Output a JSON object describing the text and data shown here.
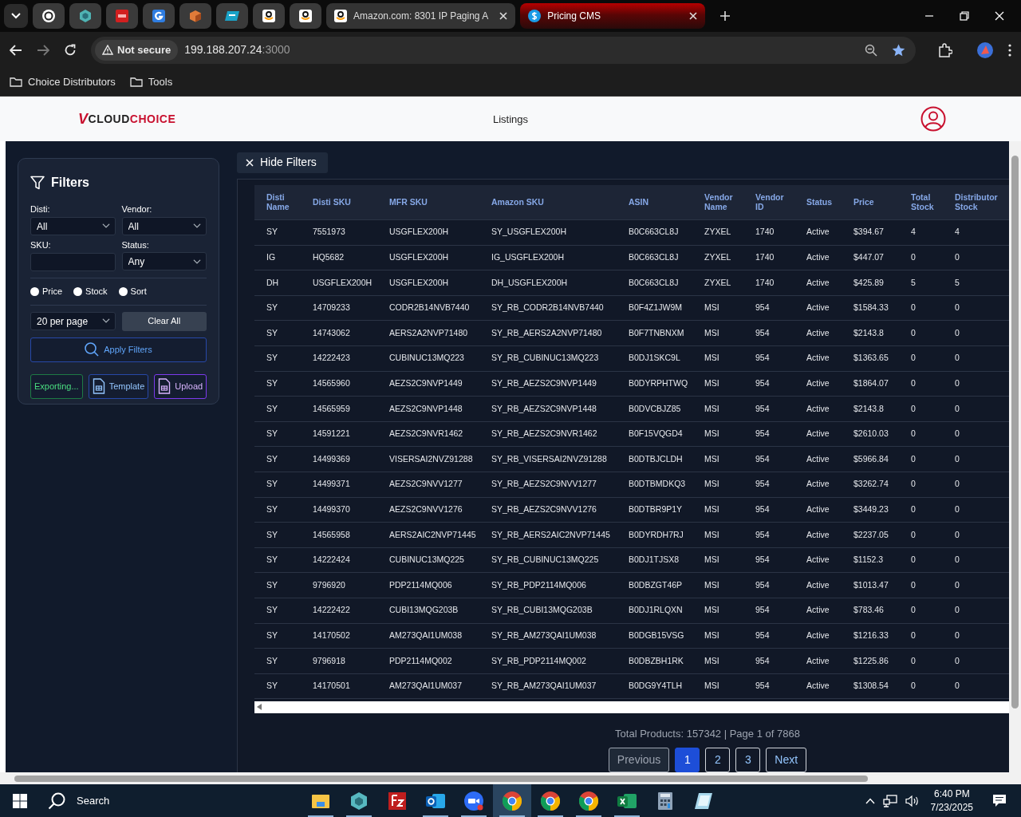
{
  "browser": {
    "tabs": [
      {
        "kind": "swirl",
        "selected": false
      },
      {
        "kind": "hexagon",
        "selected": false
      },
      {
        "kind": "tile",
        "selected": false
      },
      {
        "kind": "g-square",
        "selected": false
      },
      {
        "kind": "cube",
        "selected": false
      },
      {
        "kind": "badge",
        "selected": false
      },
      {
        "kind": "smile",
        "selected": false
      },
      {
        "kind": "smile",
        "selected": false
      },
      {
        "kind": "smile",
        "title": "Amazon.com: 8301 IP Paging A",
        "selected": false
      },
      {
        "kind": "dollar",
        "title": "Pricing CMS",
        "selected": true
      }
    ],
    "address": {
      "security": "Not secure",
      "host": "199.188.207.24",
      "port": ":3000"
    },
    "bookmarks": [
      "Choice Distributors",
      "Tools"
    ]
  },
  "app": {
    "logo": {
      "mark": "V",
      "word_1": "CLOUD",
      "word_2": "CHOICE"
    },
    "nav": "Listings"
  },
  "filters": {
    "title": "Filters",
    "fields": [
      {
        "label": "Disti:",
        "kind": "select",
        "value": "All"
      },
      {
        "label": "Vendor:",
        "kind": "select",
        "value": "All"
      },
      {
        "label": "SKU:",
        "kind": "text"
      },
      {
        "label": "Status:",
        "kind": "select",
        "value": "Any"
      }
    ],
    "radios": [
      {
        "label": "Price",
        "selected": false
      },
      {
        "label": "Stock",
        "selected": false
      },
      {
        "label": "Sort",
        "selected": false
      }
    ],
    "per_page": "20 per page",
    "clear": "Clear All",
    "apply": "Apply Filters",
    "actions": [
      {
        "label": "Exporting...",
        "kind": "export"
      },
      {
        "label": "Template",
        "kind": "template"
      },
      {
        "label": "Upload",
        "kind": "upload"
      }
    ]
  },
  "hide_filters": "Hide Filters",
  "table": {
    "columns": [
      "Disti Name",
      "Disti SKU",
      "MFR SKU",
      "Amazon SKU",
      "ASIN",
      "Vendor Name",
      "Vendor ID",
      "Status",
      "Price",
      "Total Stock",
      "Distributor Stock"
    ],
    "rows": [
      [
        "SY",
        "7551973",
        "USGFLEX200H",
        "SY_USGFLEX200H",
        "B0C663CL8J",
        "ZYXEL",
        "1740",
        "Active",
        "$394.67",
        "4",
        "4"
      ],
      [
        "IG",
        "HQ5682",
        "USGFLEX200H",
        "IG_USGFLEX200H",
        "B0C663CL8J",
        "ZYXEL",
        "1740",
        "Active",
        "$447.07",
        "0",
        "0"
      ],
      [
        "DH",
        "USGFLEX200H",
        "USGFLEX200H",
        "DH_USGFLEX200H",
        "B0C663CL8J",
        "ZYXEL",
        "1740",
        "Active",
        "$425.89",
        "5",
        "5"
      ],
      [
        "SY",
        "14709233",
        "CODR2B14NVB7440",
        "SY_RB_CODR2B14NVB7440",
        "B0F4Z1JW9M",
        "MSI",
        "954",
        "Active",
        "$1584.33",
        "0",
        "0"
      ],
      [
        "SY",
        "14743062",
        "AERS2A2NVP71480",
        "SY_RB_AERS2A2NVP71480",
        "B0F7TNBNXM",
        "MSI",
        "954",
        "Active",
        "$2143.8",
        "0",
        "0"
      ],
      [
        "SY",
        "14222423",
        "CUBINUC13MQ223",
        "SY_RB_CUBINUC13MQ223",
        "B0DJ1SKC9L",
        "MSI",
        "954",
        "Active",
        "$1363.65",
        "0",
        "0"
      ],
      [
        "SY",
        "14565960",
        "AEZS2C9NVP1449",
        "SY_RB_AEZS2C9NVP1449",
        "B0DYRPHTWQ",
        "MSI",
        "954",
        "Active",
        "$1864.07",
        "0",
        "0"
      ],
      [
        "SY",
        "14565959",
        "AEZS2C9NVP1448",
        "SY_RB_AEZS2C9NVP1448",
        "B0DVCBJZ85",
        "MSI",
        "954",
        "Active",
        "$2143.8",
        "0",
        "0"
      ],
      [
        "SY",
        "14591221",
        "AEZS2C9NVR1462",
        "SY_RB_AEZS2C9NVR1462",
        "B0F15VQGD4",
        "MSI",
        "954",
        "Active",
        "$2610.03",
        "0",
        "0"
      ],
      [
        "SY",
        "14499369",
        "VISERSAI2NVZ91288",
        "SY_RB_VISERSAI2NVZ91288",
        "B0DTBJCLDH",
        "MSI",
        "954",
        "Active",
        "$5966.84",
        "0",
        "0"
      ],
      [
        "SY",
        "14499371",
        "AEZS2C9NVV1277",
        "SY_RB_AEZS2C9NVV1277",
        "B0DTBMDKQ3",
        "MSI",
        "954",
        "Active",
        "$3262.74",
        "0",
        "0"
      ],
      [
        "SY",
        "14499370",
        "AEZS2C9NVV1276",
        "SY_RB_AEZS2C9NVV1276",
        "B0DTBR9P1Y",
        "MSI",
        "954",
        "Active",
        "$3449.23",
        "0",
        "0"
      ],
      [
        "SY",
        "14565958",
        "AERS2AIC2NVP71445",
        "SY_RB_AERS2AIC2NVP71445",
        "B0DYRDH7RJ",
        "MSI",
        "954",
        "Active",
        "$2237.05",
        "0",
        "0"
      ],
      [
        "SY",
        "14222424",
        "CUBINUC13MQ225",
        "SY_RB_CUBINUC13MQ225",
        "B0DJ1TJSX8",
        "MSI",
        "954",
        "Active",
        "$1152.3",
        "0",
        "0"
      ],
      [
        "SY",
        "9796920",
        "PDP2114MQ006",
        "SY_RB_PDP2114MQ006",
        "B0DBZGT46P",
        "MSI",
        "954",
        "Active",
        "$1013.47",
        "0",
        "0"
      ],
      [
        "SY",
        "14222422",
        "CUBI13MQG203B",
        "SY_RB_CUBI13MQG203B",
        "B0DJ1RLQXN",
        "MSI",
        "954",
        "Active",
        "$783.46",
        "0",
        "0"
      ],
      [
        "SY",
        "14170502",
        "AM273QAI1UM038",
        "SY_RB_AM273QAI1UM038",
        "B0DGB15VSG",
        "MSI",
        "954",
        "Active",
        "$1216.33",
        "0",
        "0"
      ],
      [
        "SY",
        "9796918",
        "PDP2114MQ002",
        "SY_RB_PDP2114MQ002",
        "B0DBZBH1RK",
        "MSI",
        "954",
        "Active",
        "$1225.86",
        "0",
        "0"
      ],
      [
        "SY",
        "14170501",
        "AM273QAI1UM037",
        "SY_RB_AM273QAI1UM037",
        "B0DG9Y4TLH",
        "MSI",
        "954",
        "Active",
        "$1308.54",
        "0",
        "0"
      ]
    ]
  },
  "pagination": {
    "summary": "Total Products: 157342 | Page 1 of 7868",
    "previous": {
      "label": "Previous",
      "disabled": true
    },
    "pages": [
      {
        "label": "1",
        "selected": true
      },
      {
        "label": "2",
        "selected": false
      },
      {
        "label": "3",
        "selected": false
      }
    ],
    "next": {
      "label": "Next",
      "disabled": false
    }
  },
  "taskbar": {
    "search": "Search",
    "apps": [
      {
        "kind": "folder",
        "running": true,
        "selected": false
      },
      {
        "kind": "hexagon",
        "running": true,
        "selected": false
      },
      {
        "kind": "tile",
        "running": false,
        "selected": false
      },
      {
        "kind": "mail",
        "running": true,
        "selected": false
      },
      {
        "kind": "video",
        "running": true,
        "selected": false
      },
      {
        "kind": "browser",
        "running": true,
        "selected": true
      },
      {
        "kind": "browser",
        "running": true,
        "selected": false
      },
      {
        "kind": "browser",
        "running": true,
        "selected": false
      },
      {
        "kind": "sheet",
        "running": true,
        "selected": false
      },
      {
        "kind": "calculator",
        "running": false,
        "selected": false
      },
      {
        "kind": "note",
        "running": false,
        "selected": false
      }
    ],
    "time": "6:40 PM",
    "date": "7/23/2025"
  }
}
